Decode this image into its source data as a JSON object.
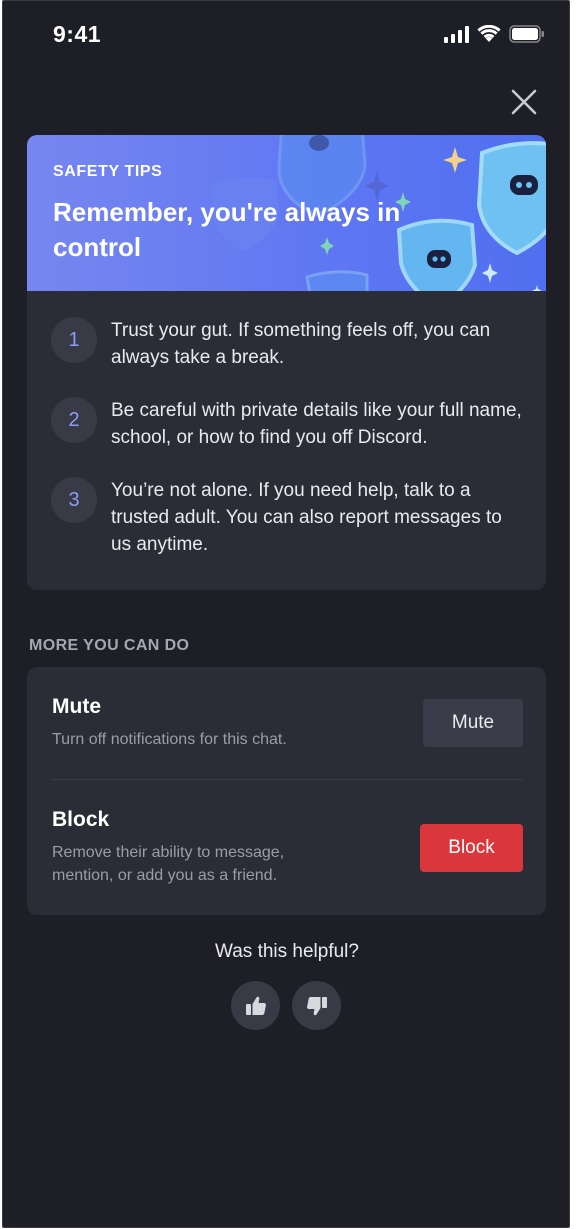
{
  "status_bar": {
    "time": "9:41"
  },
  "hero": {
    "kicker": "SAFETY TIPS",
    "title": "Remember, you're always in control"
  },
  "tips": [
    {
      "number": "1",
      "text": "Trust your gut. If something feels off, you can always take a break."
    },
    {
      "number": "2",
      "text": "Be careful with private details like your full name, school, or how to find you off Discord."
    },
    {
      "number": "3",
      "text": "You’re not alone. If you need help, talk to a trusted adult. You can also report messages to us anytime."
    }
  ],
  "more": {
    "section_label": "MORE YOU CAN DO",
    "mute": {
      "title": "Mute",
      "description": "Turn off notifications for this chat.",
      "button_label": "Mute"
    },
    "block": {
      "title": "Block",
      "description": "Remove their ability to message, mention, or add you as a friend.",
      "button_label": "Block"
    }
  },
  "feedback": {
    "question": "Was this helpful?"
  },
  "icons": {
    "close": "close-icon",
    "thumbs_up": "thumbs-up-icon",
    "thumbs_down": "thumbs-down-icon",
    "signal": "cellular-signal-icon",
    "wifi": "wifi-icon",
    "battery": "battery-icon"
  },
  "colors": {
    "background": "#1e1f26",
    "card": "#2b2d36",
    "hero_gradient_start": "#7787f0",
    "hero_gradient_end": "#4f6ff0",
    "accent_number": "#8e9cf5",
    "block_red": "#da373c"
  }
}
